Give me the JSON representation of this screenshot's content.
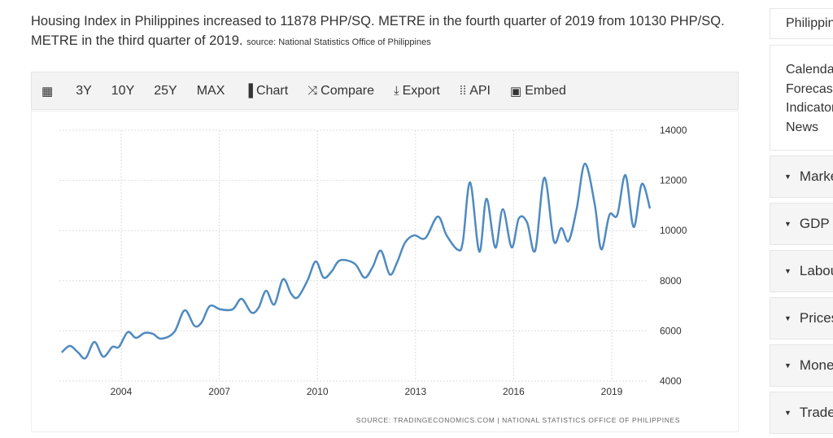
{
  "headline": {
    "text": "Housing Index in Philippines increased to 11878 PHP/SQ. METRE in the fourth quarter of 2019 from 10130 PHP/SQ. METRE in the third quarter of 2019.",
    "source": "source: National Statistics Office of Philippines"
  },
  "toolbar": [
    {
      "icon": "calendar-icon",
      "glyph": "▦",
      "label": ""
    },
    {
      "label": "3Y"
    },
    {
      "label": "10Y"
    },
    {
      "label": "25Y"
    },
    {
      "label": "MAX"
    },
    {
      "icon": "bar-chart-icon",
      "glyph": "▐",
      "label": "Chart"
    },
    {
      "icon": "shuffle-icon",
      "glyph": "⤨",
      "label": "Compare"
    },
    {
      "icon": "download-icon",
      "glyph": "⤓",
      "label": "Export"
    },
    {
      "icon": "grid-icon",
      "glyph": "⁞⁞",
      "label": "API"
    },
    {
      "icon": "image-icon",
      "glyph": "▣",
      "label": "Embed"
    }
  ],
  "sidebar": {
    "top": "Philippines",
    "links": [
      "Calendar",
      "Forecast",
      "Indicators",
      "News"
    ],
    "sections": [
      "Markets",
      "GDP",
      "Labour",
      "Prices",
      "Money",
      "Trade"
    ]
  },
  "chart_data": {
    "type": "line",
    "color": "#4f8ac0",
    "ylim": [
      4000,
      14000
    ],
    "yticks": [
      "4000",
      "6000",
      "8000",
      "10000",
      "12000",
      "14000"
    ],
    "xticks": [
      "2004",
      "2007",
      "2010",
      "2013",
      "2016",
      "2019"
    ],
    "grid": true,
    "source": "SOURCE: TRADINGECONOMICS.COM | NATIONAL STATISTICS OFFICE OF PHILIPPINES",
    "x": [
      2002.18,
      2002.43,
      2002.68,
      2002.91,
      2003.18,
      2003.45,
      2003.73,
      2003.93,
      2004.2,
      2004.45,
      2004.72,
      2004.97,
      2005.22,
      2005.62,
      2005.94,
      2006.24,
      2006.46,
      2006.71,
      2007.03,
      2007.41,
      2007.68,
      2007.98,
      2008.2,
      2008.43,
      2008.68,
      2008.95,
      2009.2,
      2009.4,
      2009.7,
      2009.95,
      2010.19,
      2010.44,
      2010.69,
      2011.14,
      2011.44,
      2011.69,
      2011.94,
      2012.21,
      2012.43,
      2012.68,
      2012.96,
      2013.3,
      2013.68,
      2013.95,
      2014.3,
      2014.45,
      2014.67,
      2014.95,
      2015.17,
      2015.44,
      2015.67,
      2015.94,
      2016.16,
      2016.41,
      2016.66,
      2016.94,
      2017.23,
      2017.46,
      2017.68,
      2017.93,
      2018.18,
      2018.48,
      2018.68,
      2018.93,
      2019.17,
      2019.42,
      2019.67,
      2019.92,
      2020.17
    ],
    "values": [
      5140,
      5400,
      5140,
      4910,
      5560,
      4970,
      5360,
      5360,
      5950,
      5720,
      5920,
      5880,
      5690,
      5950,
      6820,
      6200,
      6340,
      6990,
      6860,
      6860,
      7280,
      6730,
      6920,
      7600,
      7050,
      8060,
      7470,
      7340,
      8020,
      8770,
      8120,
      8380,
      8810,
      8680,
      8120,
      8550,
      9200,
      8250,
      8710,
      9520,
      9810,
      9700,
      10560,
      9810,
      9230,
      9580,
      11920,
      9160,
      11270,
      9320,
      10850,
      9330,
      10490,
      10330,
      9200,
      12110,
      9580,
      10100,
      9580,
      10880,
      12670,
      11050,
      9250,
      10620,
      10620,
      12210,
      10140,
      11860,
      10880
    ]
  }
}
